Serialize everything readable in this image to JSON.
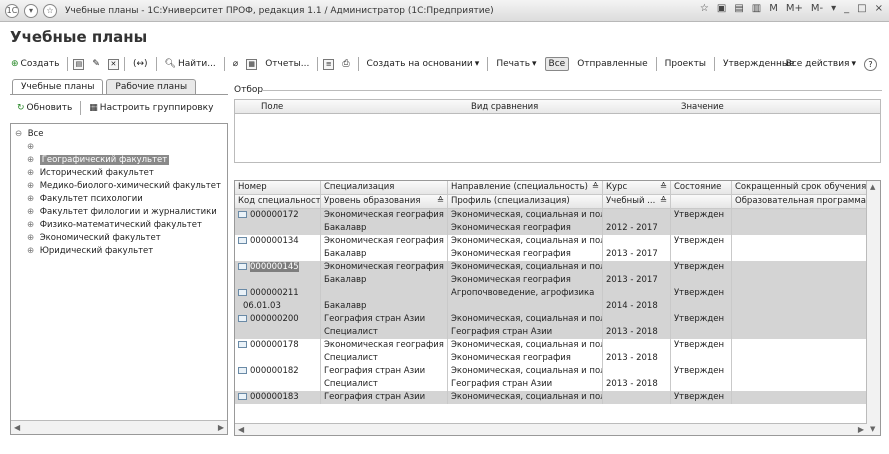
{
  "window": {
    "title": "Учебные планы - 1С:Университет ПРОФ, редакция 1.1 / Администратор (1С:Предприятие)",
    "controls": [
      "☆",
      "▣",
      "▤",
      "▥",
      "M",
      "M+",
      "M-",
      "▾",
      "_",
      "□",
      "×"
    ]
  },
  "page_title": "Учебные планы",
  "toolbar": {
    "create": "Создать",
    "find": "Найти...",
    "reports": "Отчеты...",
    "create_based": "Создать на основании",
    "print": "Печать",
    "all": "Все",
    "sent": "Отправленные",
    "projects": "Проекты",
    "approved": "Утвержденные",
    "all_actions": "Все действия",
    "help": "?"
  },
  "tabs": [
    {
      "label": "Учебные планы",
      "active": true
    },
    {
      "label": "Рабочие планы",
      "active": false
    }
  ],
  "left": {
    "refresh": "Обновить",
    "grouping": "Настроить группировку",
    "tree": [
      {
        "label": "Все",
        "exp": "⊖",
        "level": 0,
        "selected": false
      },
      {
        "label": "",
        "exp": "⊕",
        "level": 1,
        "selected": false
      },
      {
        "label": "Географический факультет",
        "exp": "⊕",
        "level": 1,
        "selected": true
      },
      {
        "label": "Исторический факультет",
        "exp": "⊕",
        "level": 1,
        "selected": false
      },
      {
        "label": "Медико-биолого-химический факультет",
        "exp": "⊕",
        "level": 1,
        "selected": false
      },
      {
        "label": "Факультет психологии",
        "exp": "⊕",
        "level": 1,
        "selected": false
      },
      {
        "label": "Факультет филологии и журналистики",
        "exp": "⊕",
        "level": 1,
        "selected": false
      },
      {
        "label": "Физико-математический факультет",
        "exp": "⊕",
        "level": 1,
        "selected": false
      },
      {
        "label": "Экономический факультет",
        "exp": "⊕",
        "level": 1,
        "selected": false
      },
      {
        "label": "Юридический факультет",
        "exp": "⊕",
        "level": 1,
        "selected": false
      }
    ]
  },
  "filter": {
    "label": "Отбор",
    "columns": [
      "Поле",
      "Вид сравнения",
      "Значение"
    ]
  },
  "table": {
    "header1": [
      "Номер",
      "Специализация",
      "Направление (специальность)",
      "Курс",
      "Состояние",
      "Сокращенный срок обучения"
    ],
    "header2": [
      "Код специальности",
      "Уровень образования",
      "Профиль (специализация)",
      "Учебный ...",
      "",
      "Образовательная программа"
    ],
    "rows": [
      {
        "gray": true,
        "doc": true,
        "sel": false,
        "cells": [
          "000000172",
          "Экономическая география",
          "Экономическая, социальная и пол...",
          "",
          "Утвержден",
          ""
        ]
      },
      {
        "gray": true,
        "doc": false,
        "sel": false,
        "cells": [
          "",
          "Бакалавр",
          "Экономическая география",
          "2012 - 2017",
          "",
          ""
        ]
      },
      {
        "gray": false,
        "doc": true,
        "sel": false,
        "cells": [
          "000000134",
          "Экономическая география",
          "Экономическая, социальная и пол...",
          "",
          "Утвержден",
          ""
        ]
      },
      {
        "gray": false,
        "doc": false,
        "sel": false,
        "cells": [
          "",
          "Бакалавр",
          "Экономическая география",
          "2013 - 2017",
          "",
          ""
        ]
      },
      {
        "gray": true,
        "doc": true,
        "sel": true,
        "cells": [
          "000000145",
          "Экономическая география",
          "Экономическая, социальная и пол...",
          "",
          "Утвержден",
          ""
        ]
      },
      {
        "gray": true,
        "doc": false,
        "sel": false,
        "cells": [
          "",
          "Бакалавр",
          "Экономическая география",
          "2013 - 2017",
          "",
          ""
        ]
      },
      {
        "gray": true,
        "doc": true,
        "sel": false,
        "cells": [
          "000000211",
          "",
          "Агропочвоведение, агрофизика",
          "",
          "Утвержден",
          ""
        ]
      },
      {
        "gray": true,
        "doc": false,
        "sel": false,
        "cells": [
          "06.01.03",
          "Бакалавр",
          "",
          "2014 - 2018",
          "",
          ""
        ]
      },
      {
        "gray": true,
        "doc": true,
        "sel": false,
        "cells": [
          "000000200",
          "География стран Азии",
          "Экономическая, социальная и пол...",
          "",
          "Утвержден",
          ""
        ]
      },
      {
        "gray": true,
        "doc": false,
        "sel": false,
        "cells": [
          "",
          "Специалист",
          "География стран Азии",
          "2013 - 2018",
          "",
          ""
        ]
      },
      {
        "gray": false,
        "doc": true,
        "sel": false,
        "cells": [
          "000000178",
          "Экономическая география",
          "Экономическая, социальная и пол...",
          "",
          "Утвержден",
          ""
        ]
      },
      {
        "gray": false,
        "doc": false,
        "sel": false,
        "cells": [
          "",
          "Специалист",
          "Экономическая география",
          "2013 - 2018",
          "",
          ""
        ]
      },
      {
        "gray": false,
        "doc": true,
        "sel": false,
        "cells": [
          "000000182",
          "География стран Азии",
          "Экономическая, социальная и пол...",
          "",
          "Утвержден",
          ""
        ]
      },
      {
        "gray": false,
        "doc": false,
        "sel": false,
        "cells": [
          "",
          "Специалист",
          "География стран Азии",
          "2013 - 2018",
          "",
          ""
        ]
      },
      {
        "gray": true,
        "doc": true,
        "sel": false,
        "cells": [
          "000000183",
          "География стран Азии",
          "Экономическая, социальная и пол...",
          "",
          "Утвержден",
          ""
        ]
      }
    ]
  }
}
